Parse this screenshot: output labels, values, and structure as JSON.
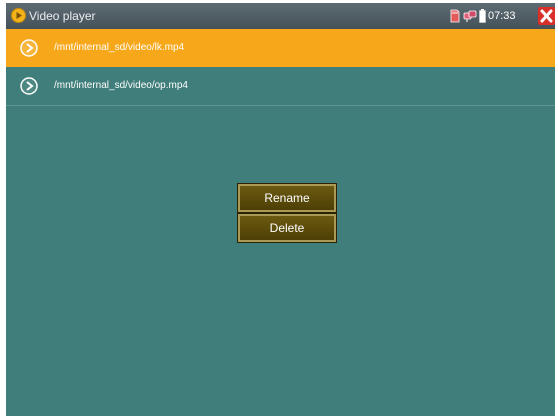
{
  "window": {
    "title": "Video player",
    "time": "07:33"
  },
  "status_icons": [
    "sd-card-icon",
    "network-icon",
    "battery-icon"
  ],
  "files": [
    {
      "path": "/mnt/internal_sd/video/lk.mp4",
      "selected": true
    },
    {
      "path": "/mnt/internal_sd/video/op.mp4",
      "selected": false
    }
  ],
  "context_menu": {
    "rename_label": "Rename",
    "delete_label": "Delete"
  },
  "colors": {
    "background": "#3f7e7a",
    "selected_row": "#f7a81a",
    "menu_button": "#5a4a0a",
    "close_button": "#d9302a"
  }
}
